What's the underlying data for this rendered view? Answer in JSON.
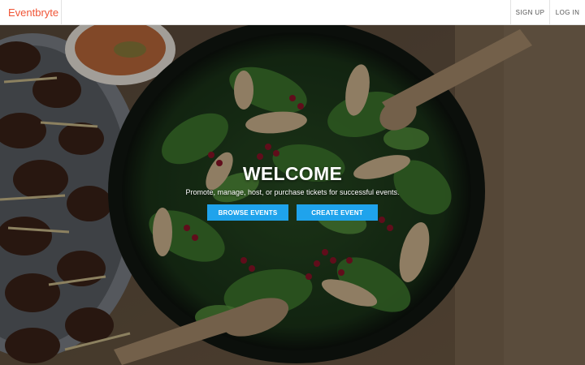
{
  "brand": {
    "name": "Eventbryte",
    "color": "#f05537"
  },
  "nav": {
    "signup_label": "SIGN UP",
    "login_label": "LOG IN"
  },
  "hero": {
    "title": "WELCOME",
    "subtitle": "Promote, manage, host, or purchase tickets for successful events.",
    "browse_label": "BROWSE EVENTS",
    "create_label": "CREATE EVENT",
    "button_color": "#1fa3ec",
    "image_subject": "salad-bowl-photo"
  }
}
